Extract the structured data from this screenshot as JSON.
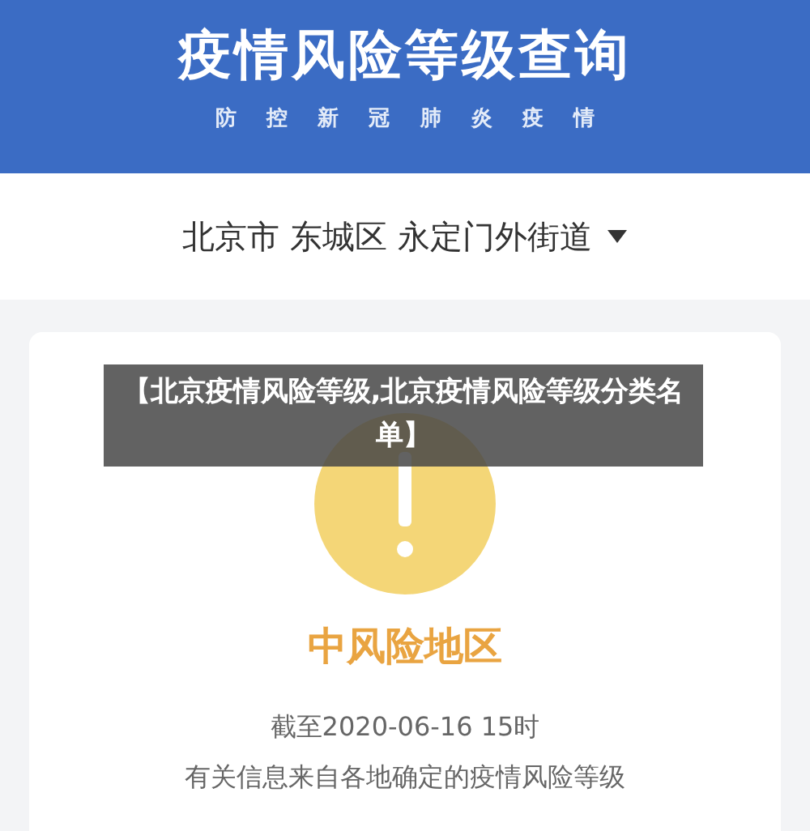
{
  "header": {
    "title": "疫情风险等级查询",
    "subtitle": "防 控 新 冠 肺 炎 疫 情"
  },
  "location": {
    "value": "北京市 东城区 永定门外街道"
  },
  "result": {
    "risk_level": "中风险地区",
    "updated": "截至2020-06-16 15时",
    "note": "有关信息来自各地确定的疫情风险等级"
  },
  "caption": "【北京疫情风险等级,北京疫情风险等级分类名单】"
}
